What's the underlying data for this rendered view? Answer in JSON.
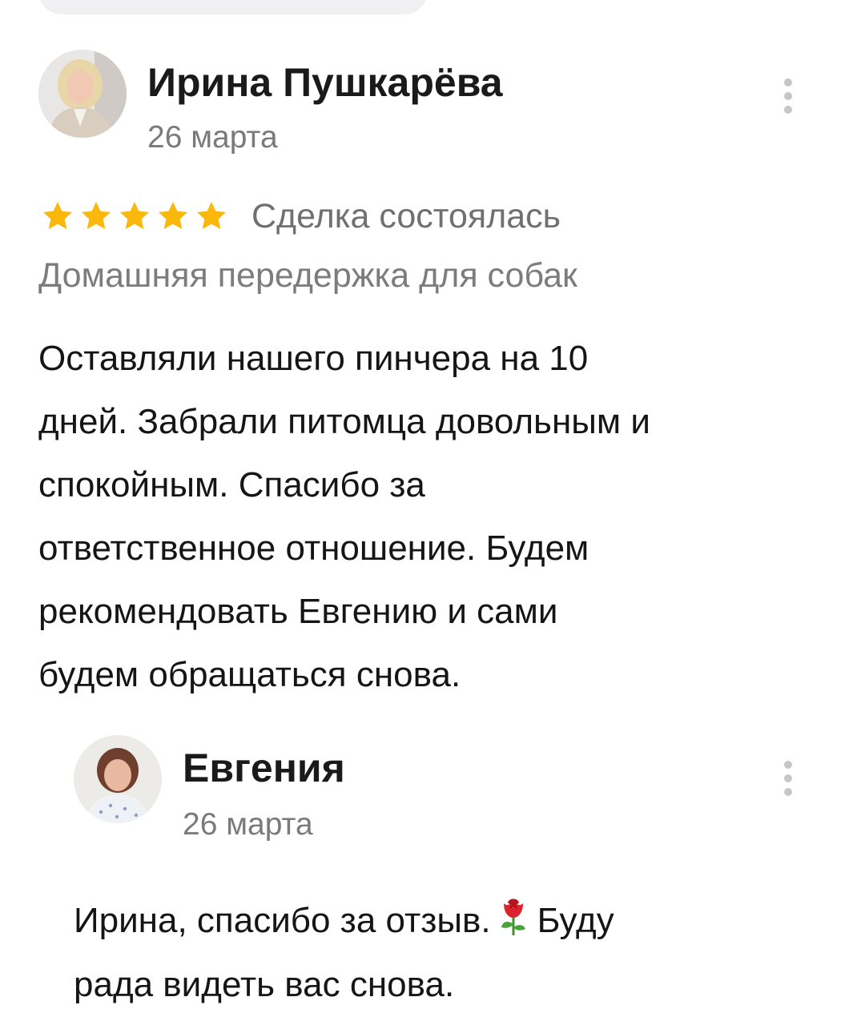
{
  "review": {
    "author": "Ирина Пушкарёва",
    "date": "26 марта",
    "stars": 5,
    "star_color": "#f9b80b",
    "deal_status": "Сделка состоялась",
    "service": "Домашняя передержка для собак",
    "text_lines": [
      "Оставляли нашего пинчера на 10",
      "дней. Забрали питомца довольным и",
      "спокойным. Спасибо за",
      "ответственное отношение. Будем",
      "рекомендовать Евгению и сами",
      "будем обращаться снова."
    ]
  },
  "reply": {
    "author": "Евгения",
    "date": "26 марта",
    "text_line1_before": "Ирина, спасибо за отзыв.",
    "emoji": "rose-emoji",
    "text_line1_after": "Буду",
    "text_line2": "рада видеть вас снова."
  }
}
